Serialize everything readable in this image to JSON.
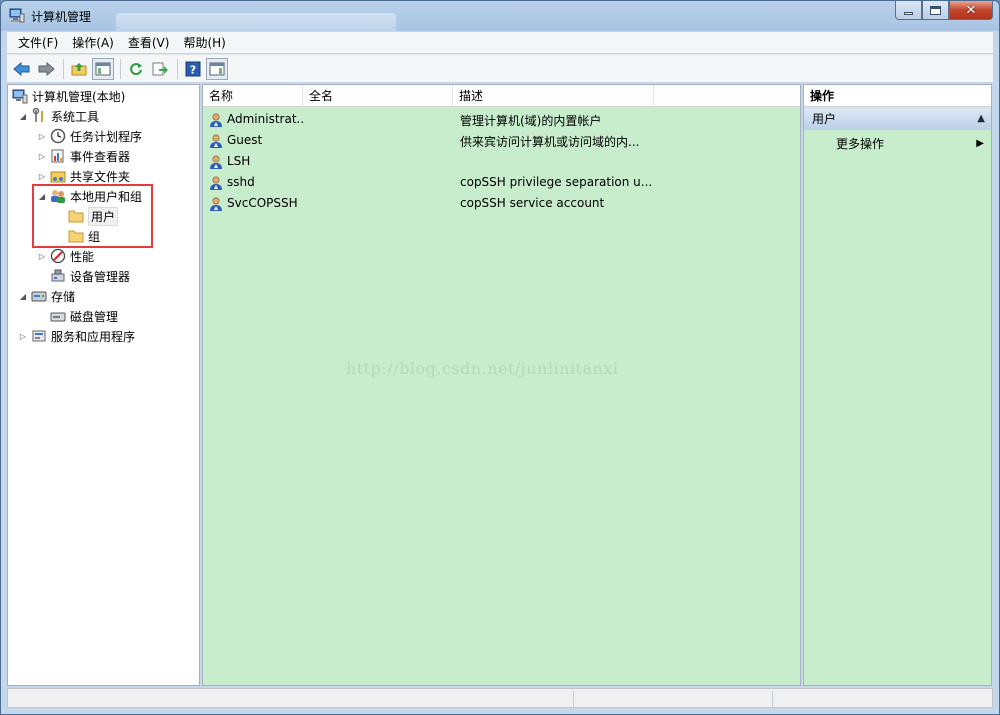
{
  "window": {
    "title": "计算机管理"
  },
  "menubar": {
    "items": [
      {
        "label": "文件(F)"
      },
      {
        "label": "操作(A)"
      },
      {
        "label": "查看(V)"
      },
      {
        "label": "帮助(H)"
      }
    ]
  },
  "toolbar": {
    "icons": [
      "back-arrow-icon",
      "forward-arrow-icon",
      "up-folder-icon",
      "show-hide-tree-icon",
      "refresh-icon",
      "export-list-icon",
      "help-icon",
      "action-pane-icon"
    ]
  },
  "tree": {
    "root": "计算机管理(本地)",
    "system_tools": "系统工具",
    "task_scheduler": "任务计划程序",
    "event_viewer": "事件查看器",
    "shared_folders": "共享文件夹",
    "local_users_groups": "本地用户和组",
    "users": "用户",
    "groups": "组",
    "performance": "性能",
    "device_manager": "设备管理器",
    "storage": "存储",
    "disk_management": "磁盘管理",
    "services_apps": "服务和应用程序"
  },
  "list": {
    "columns": [
      "名称",
      "全名",
      "描述"
    ],
    "rows": [
      {
        "name": "Administrat...",
        "fullname": "",
        "description": "管理计算机(域)的内置帐户"
      },
      {
        "name": "Guest",
        "fullname": "",
        "description": "供来宾访问计算机或访问域的内..."
      },
      {
        "name": "LSH",
        "fullname": "",
        "description": ""
      },
      {
        "name": "sshd",
        "fullname": "",
        "description": "copSSH privilege separation u..."
      },
      {
        "name": "SvcCOPSSH",
        "fullname": "",
        "description": "copSSH service account"
      }
    ]
  },
  "watermark": "http://blog.csdn.net/junlinitanxi",
  "actions": {
    "header": "操作",
    "section": "用户",
    "more": "更多操作"
  },
  "colors": {
    "pane_bg": "#c7edcc",
    "highlight_border": "#e23c3c"
  }
}
